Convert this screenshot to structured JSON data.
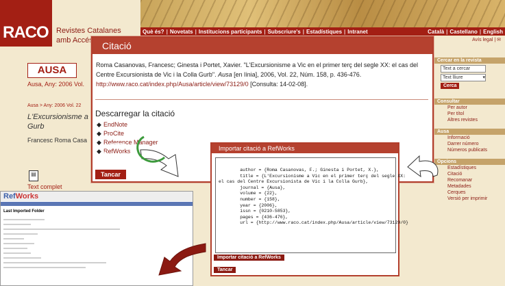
{
  "header": {
    "logo": "RACO",
    "site_name_line1": "Revistes Catalanes",
    "site_name_line2": "amb Accés",
    "nav": [
      "Què és?",
      "Novetats",
      "Institucions participants",
      "Subscriure's",
      "Estadístiques",
      "Intranet"
    ],
    "langs": [
      "Català",
      "Castellano",
      "English"
    ],
    "legal": "Avís legal"
  },
  "left": {
    "journal_logo": "AUSA",
    "journal_line": "Ausa, Any: 2006 Vol.",
    "breadcrumb": "Ausa > Any: 2006 Vol. 22",
    "article_title": "L'Excursionisme a Gurb",
    "author": "Francesc Roma Casa",
    "full_text": "Text complet"
  },
  "sidebar": {
    "search_head": "Cercar en la revista",
    "search_placeholder": "Text a cercar",
    "search_select": "Text lliure",
    "search_button": "Cerca",
    "consult_head": "Consultar",
    "consult_items": [
      "Per autor",
      "Per títol",
      "Altres revistes"
    ],
    "ausa_head": "Ausa",
    "ausa_items": [
      "Informació",
      "Darrer número",
      "Números publicats"
    ],
    "options_head": "Opcions",
    "options_items": [
      "Estadístiques",
      "Citació",
      "Recomanar",
      "Metadades",
      "Cerques",
      "Versió per imprimir"
    ]
  },
  "citation": {
    "title": "Citació",
    "text_pre": "Roma Casanovas, Francesc; Ginesta i Portet, Xavier. \"L'Excursionisme a Vic en el primer terç del segle XX: el cas del Centre Excursionista de Vic i la Colla Gurb\". ",
    "journal": "Ausa",
    "text_mid": " [en línia], 2006, Vol. 22, Núm. 158, p. 436-476. ",
    "url": "http://www.raco.cat/index.php/Ausa/article/view/73129/0",
    "text_post": " [Consulta: 14-02-08].",
    "download_head": "Descarregar la citació",
    "formats": [
      "EndNote",
      "ProCite",
      "Reference Manager",
      "RefWorks"
    ],
    "stamp": "14-02",
    "close": "Tancar"
  },
  "refworks_dialog": {
    "title": "Importar citació a RefWorks",
    "record": "        author = {Roma Casanovas, F.; Ginesta i Portet, X.},\n        title = {L'Excursionisme a Vic en el primer terç del segle XX:\nel cas del Centre Excursionista de Vic i la Colla Gurb},\n        journal = {Ausa},\n        volume = {22},\n        number = {158},\n        year = {2006},\n        issn = {0210-5853},\n        pages = {436-476},\n        url = {http://www.raco.cat/index.php/Ausa/article/view/73129/0}",
    "import_button": "Importar citació a RefWorks",
    "close": "Tancar"
  },
  "refworks_screen": {
    "logo_ref": "Ref",
    "logo_works": "Works",
    "folder_label": "Last Imported Folder"
  }
}
